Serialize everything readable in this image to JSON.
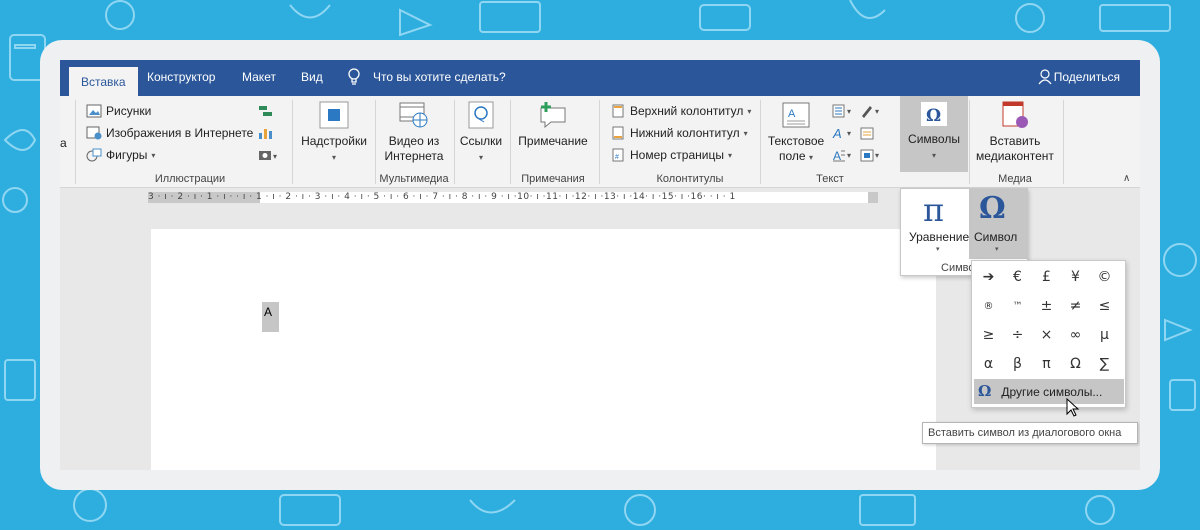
{
  "tabs": [
    {
      "label": "Вставка",
      "active": true
    },
    {
      "label": "Конструктор"
    },
    {
      "label": "Макет"
    },
    {
      "label": "Вид"
    }
  ],
  "tell_me": "Что вы хотите сделать?",
  "share_label": "Поделиться",
  "ribbon": {
    "partial_left_label": "а",
    "illustrations": {
      "items": [
        "Рисунки",
        "Изображения в Интернете",
        "Фигуры"
      ],
      "group_label": "Иллюстрации"
    },
    "addins_label": "Надстройки",
    "multimedia": {
      "button": "Видео из Интернета",
      "button_line1": "Видео из",
      "button_line2": "Интернета",
      "group_label": "Мультимедиа"
    },
    "links_label": "Ссылки",
    "comments": {
      "button": "Примечание",
      "group_label": "Примечания"
    },
    "headers": {
      "items": [
        "Верхний колонтитул",
        "Нижний колонтитул",
        "Номер страницы"
      ],
      "group_label": "Колонтитулы"
    },
    "text": {
      "textbox_line1": "Текстовое",
      "textbox_line2": "поле",
      "group_label": "Текст"
    },
    "symbols_label": "Символы",
    "media": {
      "line1": "Вставить",
      "line2": "медиаконтент",
      "group_label": "Медиа"
    }
  },
  "ruler_text": "3 · ı · 2 · ı · 1 · ı ·   · ı · 1 · ı · 2 · ı · 3 · ı · 4 · ı · 5 · ı · 6 · ı · 7 · ı · 8 · ı · 9 · ı ·10· ı ·11· ı ·12· ı ·13· ı ·14· ı ·15· ı ·16·   · ı · 1",
  "document_text": "A",
  "symbols_popup": {
    "equation_glyph": "π",
    "equation_label": "Уравнение",
    "symbol_glyph": "Ω",
    "symbol_label": "Символ",
    "group_label": "Символы",
    "group_label_visible": "Симво"
  },
  "symbol_grid": [
    [
      "➔",
      "€",
      "£",
      "¥",
      "©"
    ],
    [
      "®",
      "™",
      "±",
      "≠",
      "≤"
    ],
    [
      "≥",
      "÷",
      "×",
      "∞",
      "µ"
    ],
    [
      "α",
      "β",
      "π",
      "Ω",
      "∑"
    ]
  ],
  "more_symbols": {
    "glyph": "Ω",
    "label": "Другие символы..."
  },
  "tooltip": "Вставить символ из диалогового окна",
  "colors": {
    "accent": "#2b579a",
    "background": "#2eaedf",
    "selection": "#c6c6c6"
  }
}
